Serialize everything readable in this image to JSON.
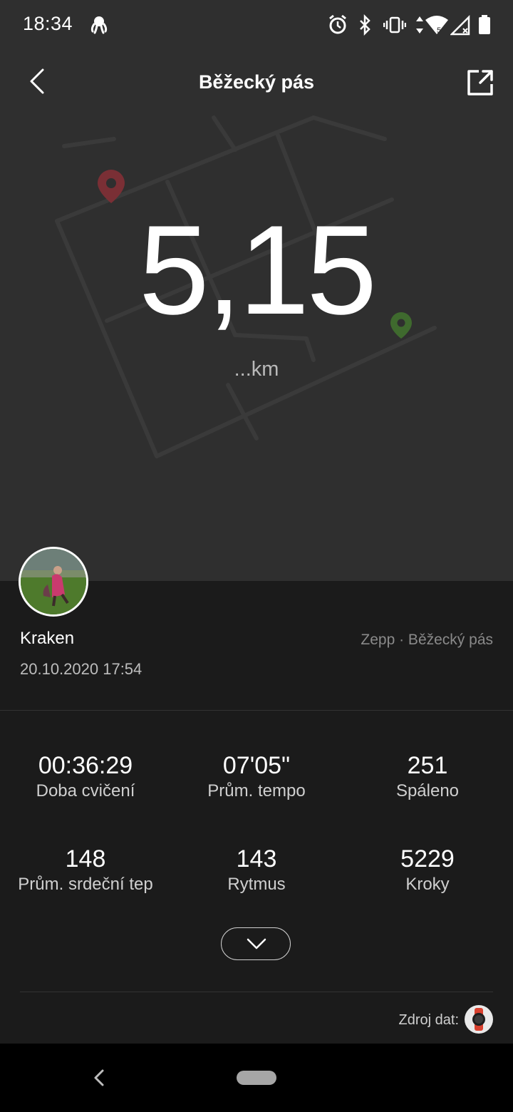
{
  "status_bar": {
    "time": "18:34",
    "icons": [
      "octopus-icon",
      "alarm-icon",
      "bluetooth-icon",
      "vibrate-icon",
      "data-arrows-icon",
      "wifi-icon",
      "signal-icon",
      "battery-icon"
    ],
    "wifi_badge": "5"
  },
  "header": {
    "title": "Běžecký pás",
    "back_icon": "chevron-left-icon",
    "share_icon": "share-icon"
  },
  "summary": {
    "distance": "5,15",
    "unit": "...km"
  },
  "user": {
    "name": "Kraken",
    "datetime": "20.10.2020 17:54",
    "source": "Zepp · Běžecký pás"
  },
  "stats": [
    {
      "value": "00:36:29",
      "label": "Doba cvičení"
    },
    {
      "value": "07'05\"",
      "label": "Prům. tempo"
    },
    {
      "value": "251",
      "label": "Spáleno"
    },
    {
      "value": "148",
      "label": "Prům. srdeční tep"
    },
    {
      "value": "143",
      "label": "Rytmus"
    },
    {
      "value": "5229",
      "label": "Kroky"
    }
  ],
  "footer": {
    "data_source_label": "Zdroj dat:"
  },
  "colors": {
    "background": "#1b1b1b",
    "hero": "#2f2f2f",
    "start_marker": "#7a2f35",
    "end_marker": "#3f6a2e"
  }
}
